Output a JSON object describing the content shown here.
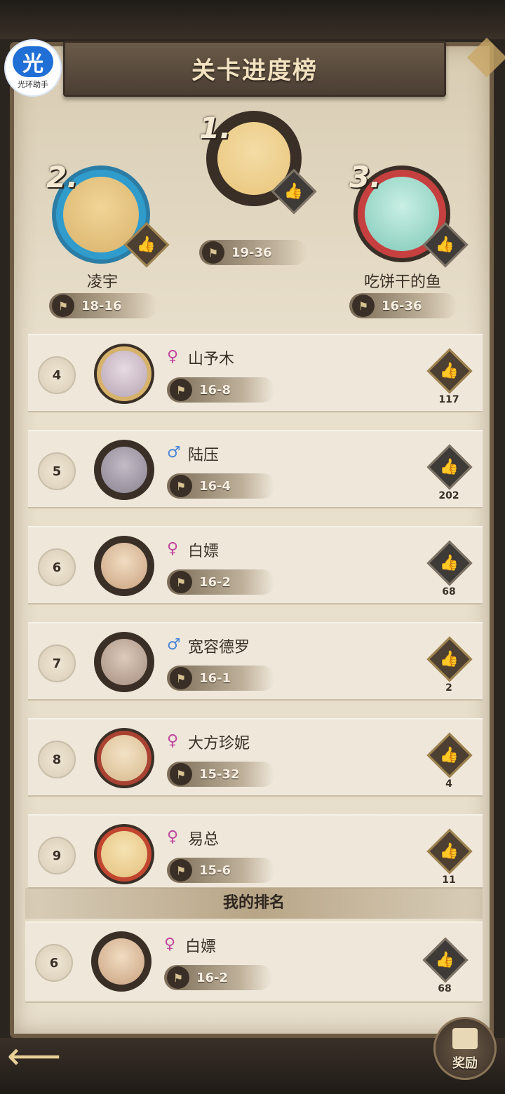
{
  "app_badge": {
    "glyph": "光",
    "name": "光环助手"
  },
  "title": "关卡进度榜",
  "podium": [
    {
      "rank": "1.",
      "name": "",
      "stage": "19-36",
      "like_icon": "thumbs-up-icon",
      "avatar_color": "#e9c57a"
    },
    {
      "rank": "2.",
      "name": "凌宇",
      "stage": "18-16",
      "like_icon": "thumbs-up-icon",
      "avatar_color": "#d9b26a"
    },
    {
      "rank": "3.",
      "name": "吃饼干的鱼",
      "stage": "16-36",
      "like_icon": "thumbs-up-icon",
      "avatar_color": "#7fc9b8"
    }
  ],
  "rows": [
    {
      "rank": "4",
      "gender": "♀",
      "name": "山予木",
      "stage": "16-8",
      "likes": "117",
      "liked": true,
      "avatar_color": "#b6a3b3"
    },
    {
      "rank": "5",
      "gender": "♂",
      "name": "陆压",
      "stage": "16-4",
      "likes": "202",
      "liked": false,
      "avatar_color": "#8a8290"
    },
    {
      "rank": "6",
      "gender": "♀",
      "name": "白嫖",
      "stage": "16-2",
      "likes": "68",
      "liked": false,
      "avatar_color": "#c9a27f"
    },
    {
      "rank": "7",
      "gender": "♂",
      "name": "宽容德罗",
      "stage": "16-1",
      "likes": "2",
      "liked": true,
      "avatar_color": "#a58e7f"
    },
    {
      "rank": "8",
      "gender": "♀",
      "name": "大方珍妮",
      "stage": "15-32",
      "likes": "4",
      "liked": true,
      "avatar_color": "#d7b98d"
    },
    {
      "rank": "9",
      "gender": "♀",
      "name": "易总",
      "stage": "15-6",
      "likes": "11",
      "liked": true,
      "avatar_color": "#e3c07c"
    }
  ],
  "my_rank": {
    "header": "我的排名",
    "rank": "6",
    "gender": "♀",
    "name": "白嫖",
    "stage": "16-2",
    "likes": "68",
    "liked": false,
    "avatar_color": "#c9a27f"
  },
  "reward_label": "奖励",
  "back_icon": "back-arrow-icon",
  "flag_icon": "flag-icon"
}
